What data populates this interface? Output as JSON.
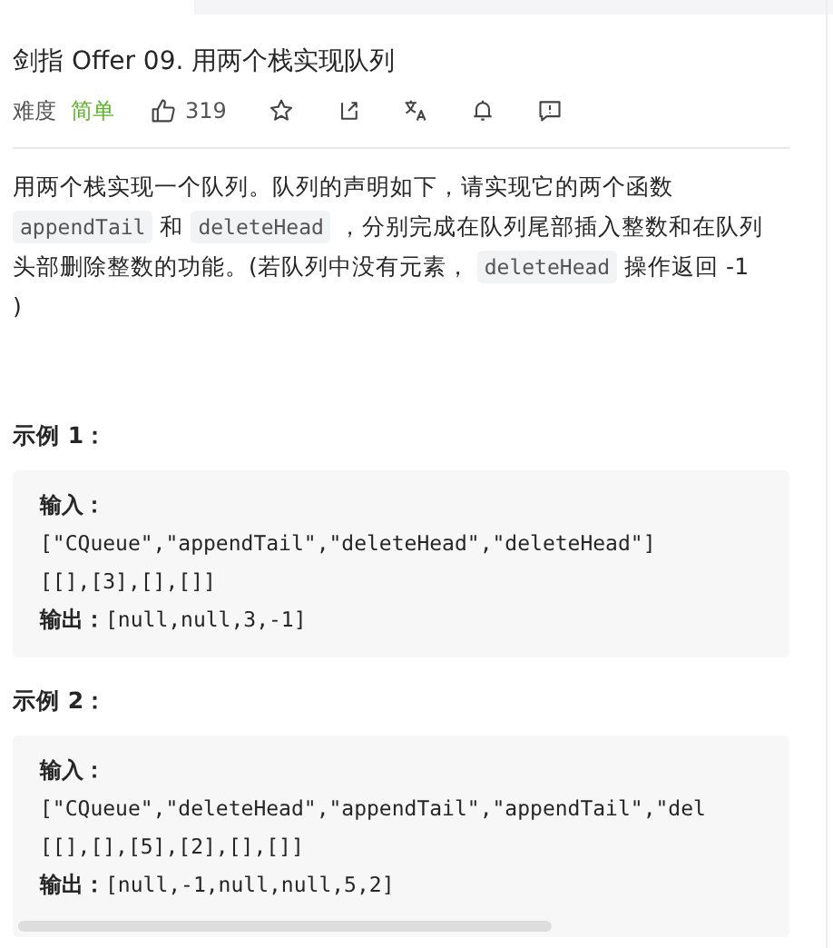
{
  "title": "剑指 Offer 09. 用两个栈实现队列",
  "meta": {
    "difficulty_label": "难度",
    "difficulty": "简单",
    "likes": "319"
  },
  "description": [
    {
      "kind": "text",
      "text": "用两个栈实现一个队列。队列的声明如下，请实现它的两个函数 "
    },
    {
      "kind": "code",
      "text": "appendTail"
    },
    {
      "kind": "text",
      "text": " 和 "
    },
    {
      "kind": "code",
      "text": "deleteHead"
    },
    {
      "kind": "text",
      "text": " ，分别完成在队列尾部插入整数和在队列头部删除整数的功能。(若队列中没有元素， "
    },
    {
      "kind": "code",
      "text": "deleteHead"
    },
    {
      "kind": "text",
      "text": " 操作返回 -1 )"
    }
  ],
  "examples": [
    {
      "heading": "示例 1：",
      "input_label": "输入：",
      "lines": [
        "[\"CQueue\",\"appendTail\",\"deleteHead\",\"deleteHead\"]",
        "[[],[3],[],[]]"
      ],
      "output_label": "输出：",
      "output": "[null,null,3,-1]"
    },
    {
      "heading": "示例 2：",
      "input_label": "输入：",
      "lines": [
        "[\"CQueue\",\"deleteHead\",\"appendTail\",\"appendTail\",\"del",
        "[[],[],[5],[2],[],[]]"
      ],
      "output_label": "输出：",
      "output": "[null,-1,null,null,5,2]"
    }
  ]
}
